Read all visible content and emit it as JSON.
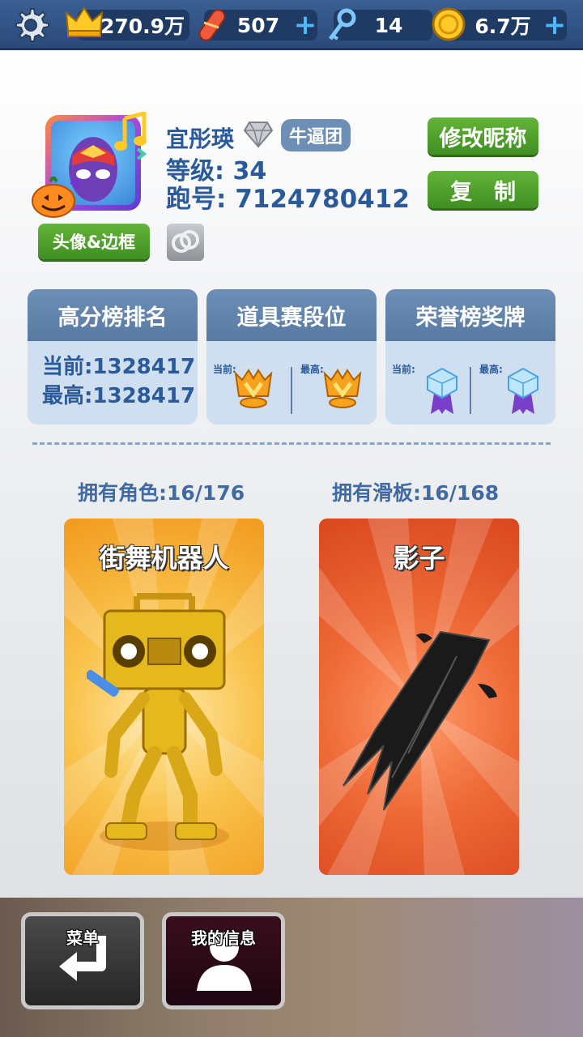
{
  "resources": {
    "score": "270.9万",
    "hoverboards": "507",
    "keys": "14",
    "coins": "6.7万"
  },
  "profile": {
    "name": "宜彤瑛",
    "crew": "牛逼团",
    "level": "等级: 34",
    "runner_id": "跑号: 7124780412",
    "rename_label": "修改昵称",
    "copy_label": "复　制",
    "avatar_frame_label": "头像&边框"
  },
  "cards": {
    "highscore": {
      "title": "高分榜排名",
      "current": "当前:1328417",
      "best": "最高:1328417"
    },
    "items": {
      "title": "道具赛段位",
      "current_label": "当前:",
      "best_label": "最高:"
    },
    "honor": {
      "title": "荣誉榜奖牌",
      "current_label": "当前:",
      "best_label": "最高:"
    }
  },
  "collection": {
    "characters": "拥有角色:16/176",
    "boards": "拥有滑板:16/168",
    "character_name": "街舞机器人",
    "board_name": "影子"
  },
  "bottom": {
    "menu_label": "菜单",
    "info_label": "我的信息"
  },
  "colors": {
    "accent_blue": "#2b5a9a",
    "button_green": "#4f9e2c",
    "card_orange": "#f6a623",
    "card_red": "#e2542a"
  },
  "icons": [
    "gear-icon",
    "crown-icon",
    "hoverboard-icon",
    "key-icon",
    "coin-icon",
    "plus-icon",
    "diamond-icon",
    "trophy-icon",
    "medal-icon",
    "back-arrow-icon",
    "user-icon"
  ]
}
